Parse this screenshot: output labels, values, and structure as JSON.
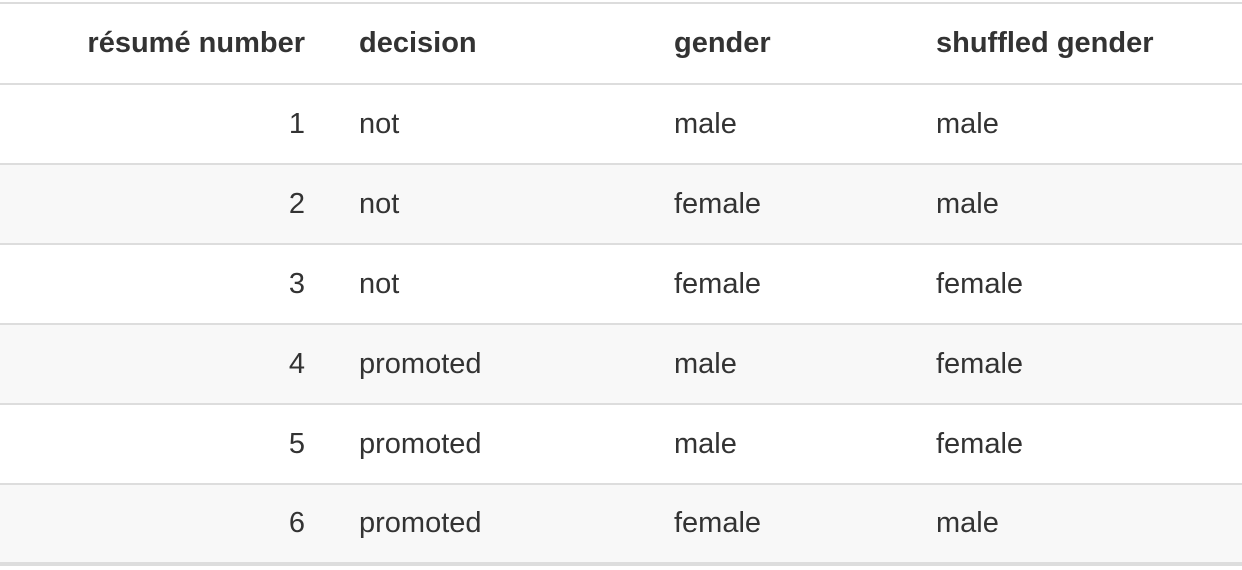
{
  "table": {
    "headers": [
      "résumé number",
      "decision",
      "gender",
      "shuffled gender"
    ],
    "rows": [
      [
        "1",
        "not",
        "male",
        "male"
      ],
      [
        "2",
        "not",
        "female",
        "male"
      ],
      [
        "3",
        "not",
        "female",
        "female"
      ],
      [
        "4",
        "promoted",
        "male",
        "female"
      ],
      [
        "5",
        "promoted",
        "male",
        "female"
      ],
      [
        "6",
        "promoted",
        "female",
        "male"
      ]
    ]
  }
}
